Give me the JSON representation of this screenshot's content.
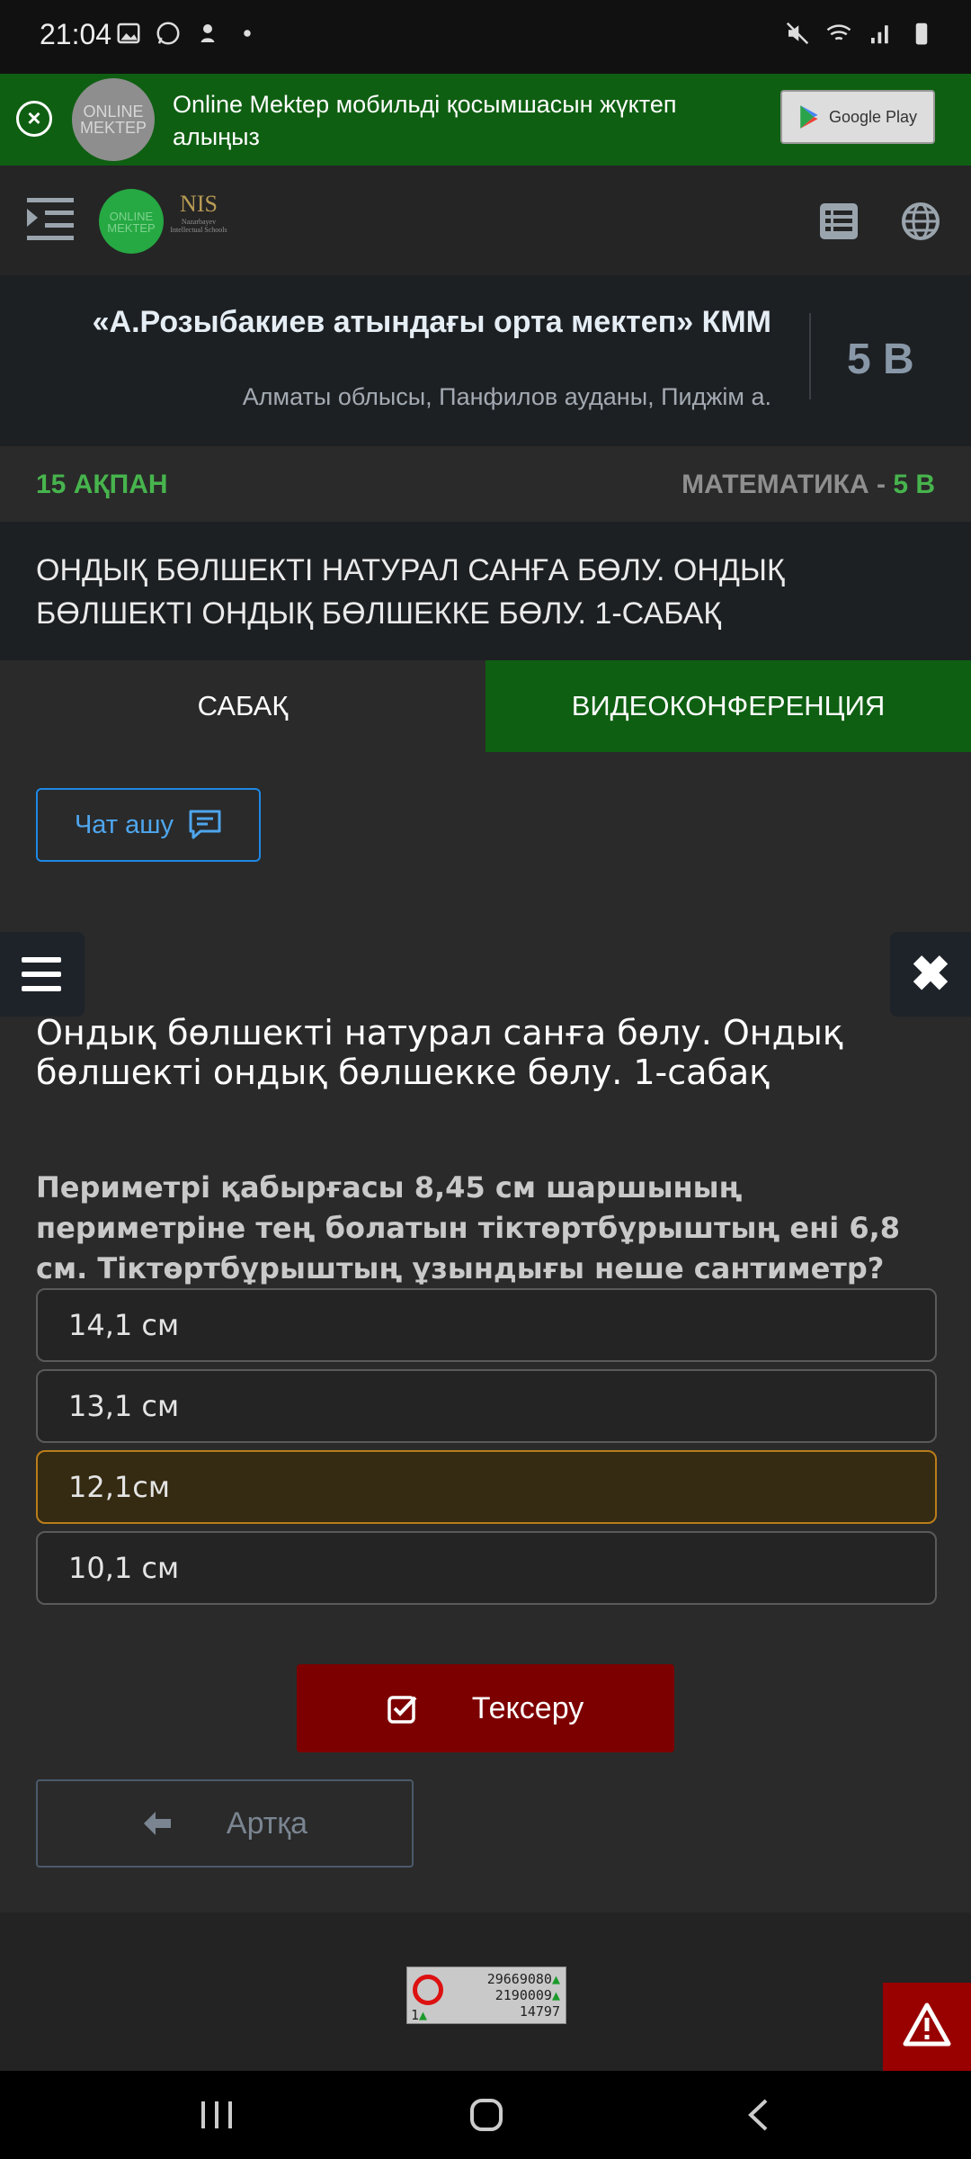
{
  "status_bar": {
    "time": "21:04"
  },
  "promo": {
    "logo_text": "ONLINE MEKTEP",
    "text": "Online Mektep мобильді қосымшасын жүктеп алыңыз",
    "store_label": "Google Play"
  },
  "nav": {
    "logo_text": "ONLINE MEKTEP",
    "nis_text": "NIS",
    "nis_sub": "Nazarbayev Intellectual Schools"
  },
  "school": {
    "name": "«А.Розыбакиев атындағы орта мектеп» КММ",
    "address": "Алматы облысы, Панфилов ауданы, Пиджім а.",
    "class": "5 В"
  },
  "lesson_bar": {
    "date": "15 АҚПАН",
    "subject": "МАТЕМАТИКА - ",
    "class": "5 В"
  },
  "lesson_title": "ОНДЫҚ БӨЛШЕКТІ НАТУРАЛ САНҒА БӨЛУ. ОНДЫҚ БӨЛШЕКТІ ОНДЫҚ БӨЛШЕККЕ БӨЛУ. 1-САБАҚ",
  "tabs": [
    {
      "label": "САБАҚ"
    },
    {
      "label": "ВИДЕОКОНФЕРЕНЦИЯ"
    }
  ],
  "chat_button": "Чат ашу",
  "content": {
    "title": "Ондық бөлшекті натурал санға бөлу. Ондық бөлшекті ондық бөлшекке бөлу. 1-сабақ",
    "question": "Периметрі қабырғасы 8,45 см шаршының периметріне тең болатын тіктөртбұрыштың ені 6,8 см. Тіктөртбұрыштың ұзындығы неше сантиметр?",
    "options": [
      "14,1 см",
      "13,1 см",
      "12,1см",
      "10,1 см"
    ],
    "selected_option": "12,1см"
  },
  "buttons": {
    "check": "Тексеру",
    "back": "Артқа"
  },
  "counter": {
    "line1": "29669080",
    "line2": "2190009",
    "line3": "14797",
    "line4": "1"
  },
  "colors": {
    "green": "#0f5f12",
    "accent_green": "#47b44d",
    "check_red": "#7d0000",
    "selected_border": "#b97d1a"
  }
}
